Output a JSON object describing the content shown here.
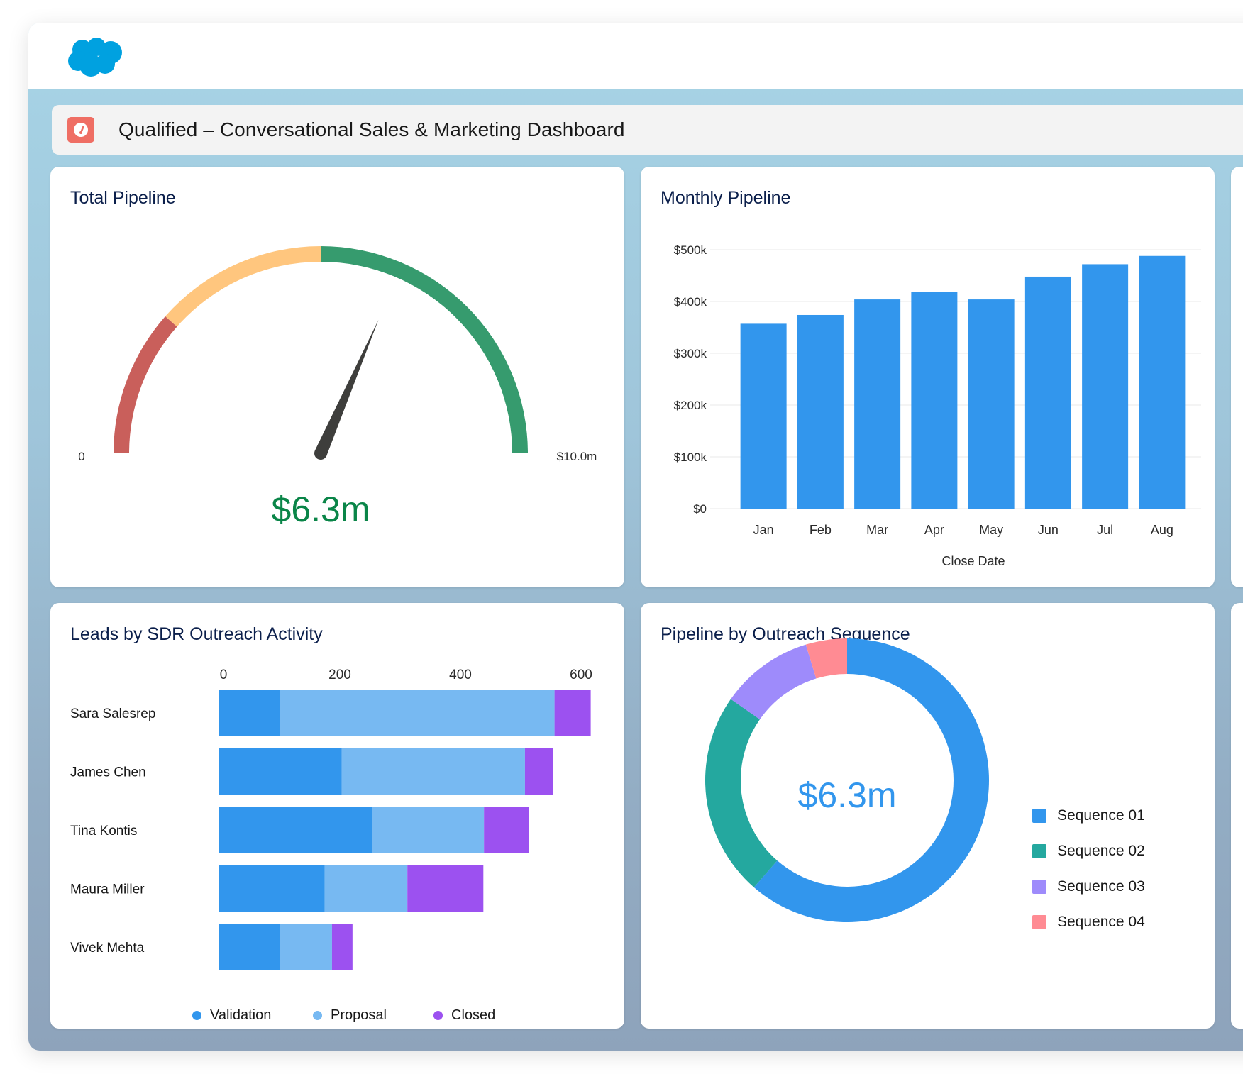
{
  "app": {
    "logo": "salesforce-cloud-logo",
    "dashboard_icon": "gauge-icon",
    "dashboard_title": "Qualified – Conversational Sales & Marketing Dashboard"
  },
  "colors": {
    "brand_blue": "#00a1e0",
    "dashboard_icon_bg": "#ef6e64",
    "title_navy": "#0b1f4b",
    "bar_blue": "#3296ed",
    "validation": "#3296ed",
    "proposal": "#77b9f2",
    "closed": "#9c51f0",
    "gauge_red": "#c95f5b",
    "gauge_yellow": "#ffc67e",
    "gauge_green": "#369b6e",
    "gauge_value": "#0a8548",
    "needle": "#3e3e3c",
    "seq01": "#3296ed",
    "seq02": "#24a89f",
    "seq03": "#9e8bfb",
    "seq04": "#ff8b93"
  },
  "cards": {
    "total_pipeline": {
      "title": "Total Pipeline"
    },
    "monthly_pipeline": {
      "title": "Monthly Pipeline"
    },
    "leads_by_sdr": {
      "title": "Leads by SDR Outreach Activity"
    },
    "pipeline_by_sequence": {
      "title": "Pipeline by Outreach Sequence"
    }
  },
  "chart_data": [
    {
      "id": "total_pipeline",
      "type": "gauge",
      "title": "Total Pipeline",
      "min": 0,
      "max": 10.0,
      "unit": "$m",
      "min_label": "0",
      "max_label": "$10.0m",
      "value": 6.3,
      "value_label": "$6.3m",
      "bands": [
        {
          "name": "low",
          "from": 0,
          "to": 2.3,
          "color": "#c95f5b"
        },
        {
          "name": "medium",
          "from": 2.3,
          "to": 5.0,
          "color": "#ffc67e"
        },
        {
          "name": "high",
          "from": 5.0,
          "to": 10.0,
          "color": "#369b6e"
        }
      ]
    },
    {
      "id": "monthly_pipeline",
      "type": "bar",
      "title": "Monthly Pipeline",
      "xlabel": "Close Date",
      "ylabel": "",
      "categories": [
        "Jan",
        "Feb",
        "Mar",
        "Apr",
        "May",
        "Jun",
        "Jul",
        "Aug"
      ],
      "values": [
        357000,
        374000,
        404000,
        418000,
        404000,
        448000,
        472000,
        488000
      ],
      "ylim": [
        0,
        500000
      ],
      "yticks": [
        0,
        100000,
        200000,
        300000,
        400000,
        500000
      ],
      "ytick_labels": [
        "$0",
        "$100k",
        "$200k",
        "$300k",
        "$400k",
        "$500k"
      ],
      "grid": true,
      "legend": "none"
    },
    {
      "id": "leads_by_sdr",
      "type": "bar",
      "orientation": "horizontal",
      "stacked": true,
      "title": "Leads by SDR Outreach Activity",
      "categories": [
        "Sara Salesrep",
        "James Chen",
        "Tina Kontis",
        "Maura Miller",
        "Vivek Mehta"
      ],
      "series": [
        {
          "name": "Validation",
          "values": [
            100,
            203,
            253,
            175,
            100
          ]
        },
        {
          "name": "Proposal",
          "values": [
            456,
            304,
            186,
            137,
            87
          ]
        },
        {
          "name": "Closed",
          "values": [
            60,
            46,
            74,
            126,
            34
          ]
        }
      ],
      "xlim": [
        0,
        620
      ],
      "xticks": [
        0,
        200,
        400,
        600
      ],
      "xtick_labels": [
        "0",
        "200",
        "400",
        "600"
      ],
      "grid": false,
      "legend": "bottom"
    },
    {
      "id": "pipeline_by_sequence",
      "type": "pie",
      "donut": true,
      "title": "Pipeline by Outreach Sequence",
      "center_label": "$6.3m",
      "labels": [
        "Sequence 01",
        "Sequence 02",
        "Sequence 03",
        "Sequence 04"
      ],
      "values": [
        61.4,
        23.3,
        10.6,
        4.7
      ],
      "value_unit": "percent",
      "legend": "right"
    }
  ]
}
